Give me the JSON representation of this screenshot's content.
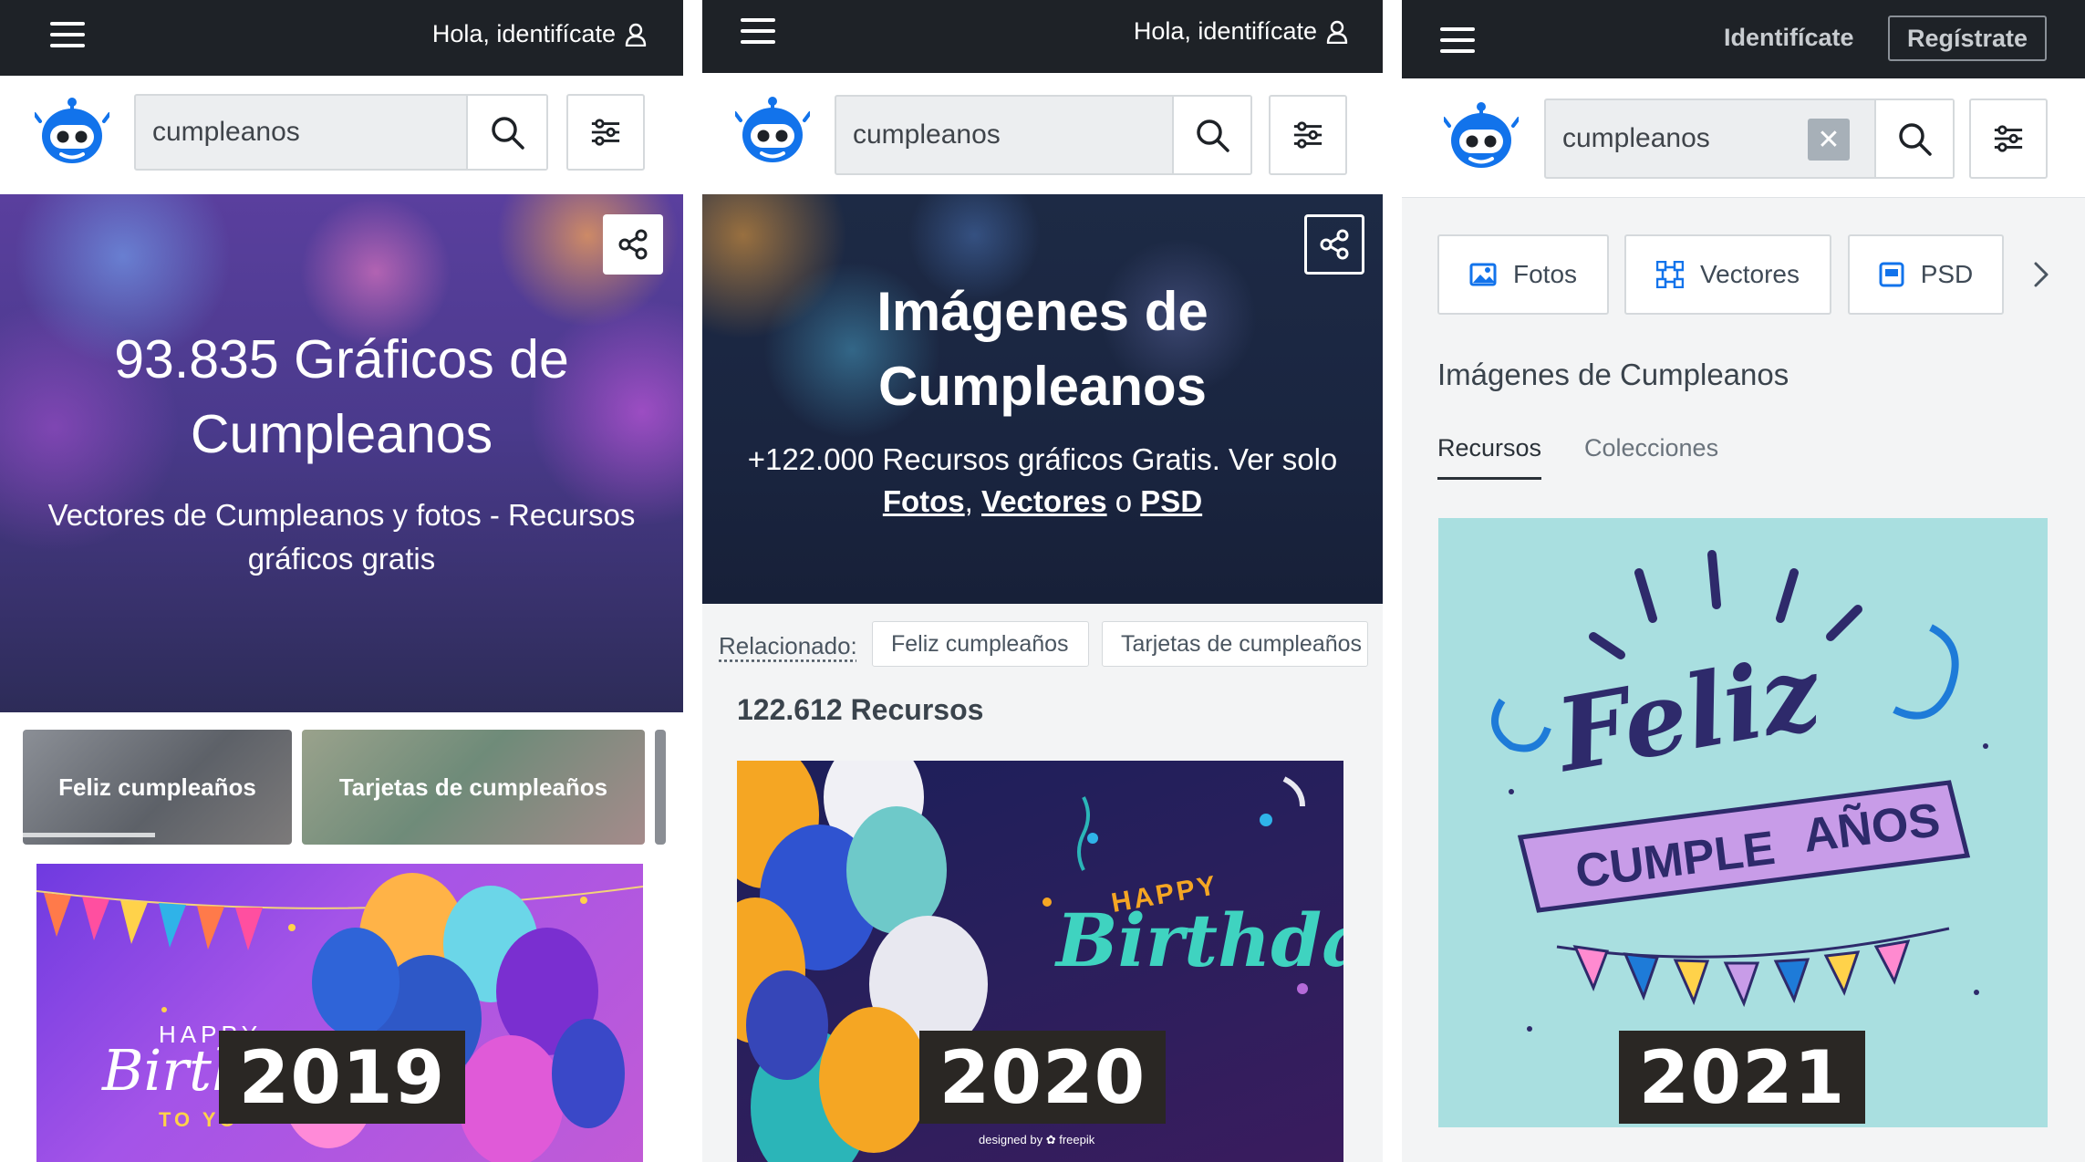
{
  "panel1": {
    "login": "Hola, identifícate",
    "search_value": "cumpleanos",
    "hero_title": "93.835 Gráficos de Cumpleanos",
    "hero_subtitle": "Vectores de Cumpleanos y fotos - Recursos gráficos gratis",
    "chips": [
      "Feliz cumpleaños",
      "Tarjetas de cumpleaños"
    ],
    "year": "2019",
    "thumb_text_happy": "HAPPY",
    "thumb_text_birth": "Birth",
    "thumb_text_toyou": "TO YO"
  },
  "panel2": {
    "login": "Hola, identifícate",
    "search_value": "cumpleanos",
    "hero_title": "Imágenes de Cumpleanos",
    "hero_sub_prefix": "+122.000 Recursos gráficos Gratis. Ver solo",
    "hero_link_fotos": "Fotos",
    "hero_link_vectores": "Vectores",
    "hero_link_psd": "PSD",
    "hero_sep_comma": ",",
    "hero_sep_o": "o",
    "related_label": "Relacionado:",
    "related_tags": [
      "Feliz cumpleaños",
      "Tarjetas de cumpleaños"
    ],
    "count": "122.612 Recursos",
    "year": "2020",
    "thumb_happy": "HAPPY",
    "thumb_birthday": "Birthday",
    "thumb_credit": "designed by ✿ freepik"
  },
  "panel3": {
    "login": "Identifícate",
    "register": "Regístrate",
    "search_value": "cumpleanos",
    "types": [
      "Fotos",
      "Vectores",
      "PSD"
    ],
    "title": "Imágenes de Cumpleanos",
    "tabs": [
      "Recursos",
      "Colecciones"
    ],
    "year": "2021",
    "thumb_feliz": "Feliz",
    "thumb_cumple": "CUMPLE",
    "thumb_anos": "AÑOS"
  },
  "colors": {
    "topbar": "#1e2227",
    "search_bg": "#eceef0",
    "logo_blue": "#1273eb",
    "year_badge": "#2a2724",
    "teal_card": "#a9dfe0"
  },
  "icons": [
    "hamburger-icon",
    "user-icon",
    "robot-logo-icon",
    "search-icon",
    "filter-icon",
    "share-icon",
    "clear-icon",
    "photo-icon",
    "vector-icon",
    "psd-icon",
    "chevron-right-icon"
  ]
}
